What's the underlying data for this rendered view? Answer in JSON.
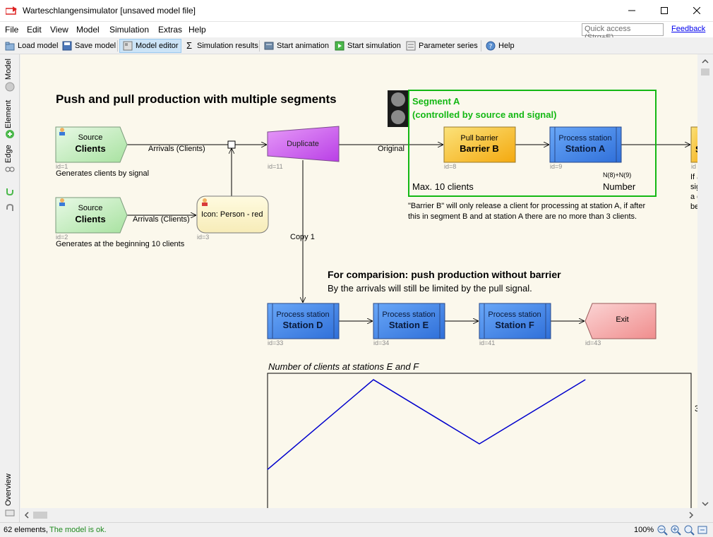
{
  "window": {
    "title": "Warteschlangensimulator [unsaved model file]"
  },
  "menu": {
    "items": [
      "File",
      "Edit",
      "View",
      "Model",
      "Simulation",
      "Extras",
      "Help"
    ],
    "quick_access_placeholder": "Quick access (Strg+E)",
    "feedback": "Feedback"
  },
  "toolbar": {
    "load_model": "Load model",
    "save_model": "Save model",
    "model_editor": "Model editor",
    "simulation_results": "Simulation results",
    "start_animation": "Start animation",
    "start_simulation": "Start simulation",
    "parameter_series": "Parameter series",
    "help": "Help"
  },
  "sidebar": {
    "tabs": [
      "Model",
      "Element",
      "Edge"
    ],
    "overview": "Overview"
  },
  "diagram": {
    "title": "Push and pull production with multiple segments",
    "source1": {
      "type": "Source",
      "name": "Clients",
      "id": "id=1",
      "desc": "Generates clients by signal"
    },
    "source2": {
      "type": "Source",
      "name": "Clients",
      "id": "id=2",
      "desc": "Generates at the beginning 10 clients"
    },
    "arrivals1": "Arrivals (Clients)",
    "arrivals2": "Arrivals (Clients)",
    "icon_element": {
      "label": "Icon: Person - red",
      "id": "id=3"
    },
    "duplicate": {
      "label": "Duplicate",
      "id": "id=11"
    },
    "original": "Original",
    "copy1": "Copy 1",
    "segment": {
      "title_line1": "Segment A",
      "title_line2": "(controlled by source and signal)",
      "max": "Max. 10 clients",
      "formula": "N(8)+N(9)",
      "number": "Number"
    },
    "barrier": {
      "type": "Pull barrier",
      "name": "Barrier B",
      "id": "id=8"
    },
    "stationA": {
      "type": "Process station",
      "name": "Station A",
      "id": "id=9"
    },
    "right_partial": {
      "name": "S",
      "id": "id",
      "text": [
        "If a",
        "sig",
        "a c",
        "be"
      ]
    },
    "barrier_note_1": "\"Barrier B\" will only release a client for processing at station A, if after",
    "barrier_note_2": "this in segment B and at station A there are no more than 3 clients.",
    "comparison_title": "For comparision: push production without barrier",
    "comparison_sub": "By the arrivals will still be limited by the pull signal.",
    "stationD": {
      "type": "Process station",
      "name": "Station D",
      "id": "id=33"
    },
    "stationE": {
      "type": "Process station",
      "name": "Station E",
      "id": "id=34"
    },
    "stationF": {
      "type": "Process station",
      "name": "Station F",
      "id": "id=41"
    },
    "exit": {
      "label": "Exit",
      "id": "id=43"
    },
    "chart_title": "Number of clients at stations E and F",
    "chart_axis_tick": "3"
  },
  "chart_data": {
    "type": "line",
    "title": "Number of clients at stations E and F",
    "x": [
      0,
      1,
      2,
      3
    ],
    "series": [
      {
        "values": [
          1.35,
          2.05,
          1.55,
          2.05
        ]
      }
    ],
    "ylim": [
      1,
      2.1
    ],
    "color": "#0000cc"
  },
  "status": {
    "elements": "62 elements,",
    "ok": "The model is ok.",
    "zoom": "100%"
  },
  "colors": {
    "segment_border": "#14b814",
    "segment_text": "#14b814",
    "process_blue": "#3d8cf0",
    "barrier_yellow": "#f9c733",
    "source_green": "#c8f0c0",
    "exit_pink": "#f5a0a0",
    "duplicate_purple": "#d060f0",
    "canvas_bg": "#fbf8ec"
  }
}
